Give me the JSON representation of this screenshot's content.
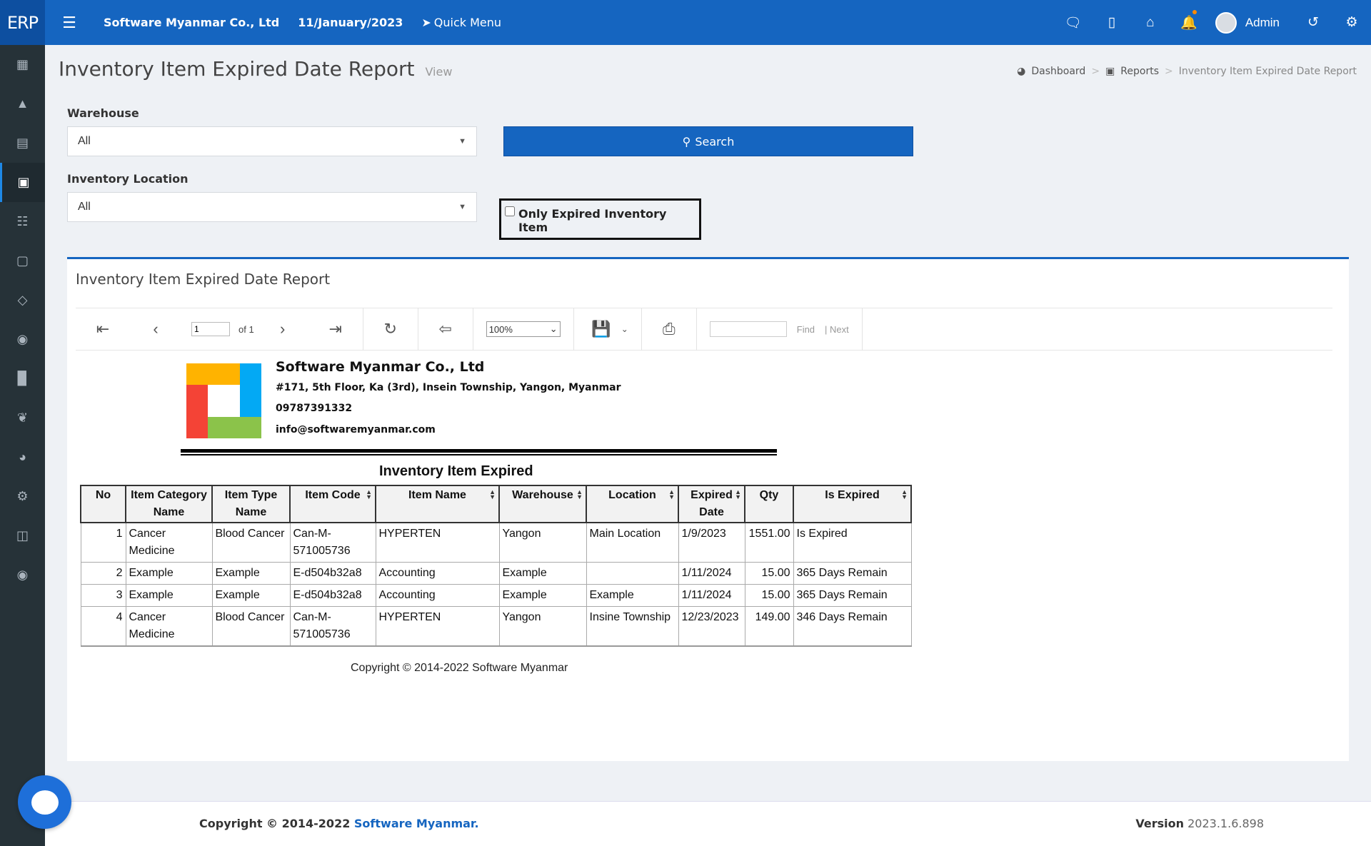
{
  "header": {
    "brand": "ERP",
    "company": "Software Myanmar Co., Ltd",
    "date": "11/January/2023",
    "quick_menu": "Quick Menu",
    "user": "Admin",
    "icons": [
      "wechat-icon",
      "building-icon",
      "home-icon",
      "bell-icon",
      "history-icon",
      "gear-icon"
    ]
  },
  "sidebar": {
    "items": [
      "calculator-icon",
      "area-chart-icon",
      "credit-card-icon",
      "cube-icon",
      "clipboard-icon",
      "cart-icon",
      "diamond-icon",
      "users-icon",
      "bar-chart-icon",
      "leaf-icon",
      "globe-icon",
      "gear-icon",
      "book-icon",
      "comment-icon"
    ],
    "active_index": 3
  },
  "page": {
    "title": "Inventory Item Expired Date Report",
    "subtitle": "View"
  },
  "breadcrumb": {
    "dashboard": "Dashboard",
    "reports": "Reports",
    "current": "Inventory Item Expired Date Report"
  },
  "filters": {
    "warehouse_label": "Warehouse",
    "warehouse_value": "All",
    "location_label": "Inventory Location",
    "location_value": "All",
    "search_label": "Search",
    "only_expired_label": "Only Expired Inventory Item"
  },
  "report_panel": {
    "title": "Inventory Item Expired Date Report",
    "toolbar": {
      "page_value": "1",
      "of_text": "of 1",
      "zoom": "100%",
      "find": "Find",
      "next": "| Next"
    }
  },
  "report": {
    "company_name": "Software Myanmar Co., Ltd",
    "address": "#171, 5th Floor, Ka (3rd), Insein Township, Yangon, Myanmar",
    "phone": "09787391332",
    "email": "info@softwaremyanmar.com",
    "heading": "Inventory Item Expired",
    "logo_colors": [
      "#ffb300",
      "#03a9f4",
      "#f44336",
      "#8bc34a"
    ],
    "columns": [
      "No",
      "Item Category Name",
      "Item Type Name",
      "Item Code",
      "Item Name",
      "Warehouse",
      "Location",
      "Expired Date",
      "Qty",
      "Is Expired"
    ],
    "rows": [
      [
        "1",
        "Cancer Medicine",
        "Blood Cancer",
        "Can-M-571005736",
        "HYPERTEN",
        "Yangon",
        "Main Location",
        "1/9/2023",
        "1551.00",
        "Is Expired"
      ],
      [
        "2",
        "Example",
        "Example",
        "E-d504b32a8",
        "Accounting",
        "Example",
        "",
        "1/11/2024",
        "15.00",
        "365 Days Remain"
      ],
      [
        "3",
        "Example",
        "Example",
        "E-d504b32a8",
        "Accounting",
        "Example",
        "Example",
        "1/11/2024",
        "15.00",
        "365 Days Remain"
      ],
      [
        "4",
        "Cancer Medicine",
        "Blood Cancer",
        "Can-M-571005736",
        "HYPERTEN",
        "Yangon",
        "Insine Township",
        "12/23/2023",
        "149.00",
        "346 Days Remain"
      ]
    ],
    "copyright": "Copyright © 2014-2022 Software Myanmar"
  },
  "footer": {
    "copyright_prefix": "Copyright © 2014-2022 ",
    "copyright_link": "Software Myanmar.",
    "version_label": "Version",
    "version_value": "2023.1.6.898"
  }
}
